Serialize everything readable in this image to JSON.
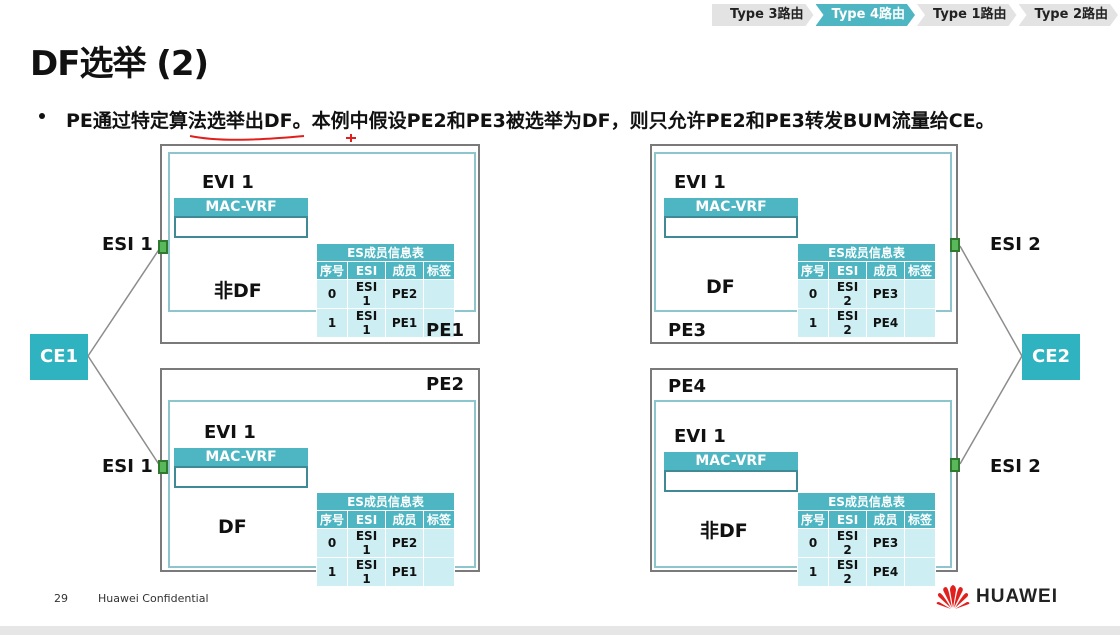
{
  "breadcrumb": {
    "items": [
      {
        "label": "Type 3路由",
        "active": false
      },
      {
        "label": "Type 4路由",
        "active": true
      },
      {
        "label": "Type 1路由",
        "active": false
      },
      {
        "label": "Type 2路由",
        "active": false
      }
    ]
  },
  "title": "DF选举 (2)",
  "bullet": "PE通过特定算法选举出DF。本例中假设PE2和PE3被选举为DF，则只允许PE2和PE3转发BUM流量给CE。",
  "colors": {
    "accent": "#4eb6c3",
    "ce_fill": "#30b3c0",
    "table_row": "#cdeef2",
    "port_green": "#59b859",
    "annotation_red": "#e0201d"
  },
  "table_caption": "ES成员信息表",
  "table_headers": [
    "序号",
    "ESI",
    "成员",
    "标签"
  ],
  "evi_label": "EVI 1",
  "macvrf_label": "MAC-VRF",
  "pes": {
    "pe1": {
      "name": "PE1",
      "role": "非DF",
      "esi_label": "ESI 1",
      "rows": [
        [
          "0",
          "ESI 1",
          "PE2",
          ""
        ],
        [
          "1",
          "ESI 1",
          "PE1",
          ""
        ]
      ]
    },
    "pe2": {
      "name": "PE2",
      "role": "DF",
      "esi_label": "ESI 1",
      "rows": [
        [
          "0",
          "ESI 1",
          "PE2",
          ""
        ],
        [
          "1",
          "ESI 1",
          "PE1",
          ""
        ]
      ]
    },
    "pe3": {
      "name": "PE3",
      "role": "DF",
      "esi_label": "ESI 2",
      "rows": [
        [
          "0",
          "ESI 2",
          "PE3",
          ""
        ],
        [
          "1",
          "ESI 2",
          "PE4",
          ""
        ]
      ]
    },
    "pe4": {
      "name": "PE4",
      "role": "非DF",
      "esi_label": "ESI 2",
      "rows": [
        [
          "0",
          "ESI 2",
          "PE3",
          ""
        ],
        [
          "1",
          "ESI 2",
          "PE4",
          ""
        ]
      ]
    }
  },
  "ce1": "CE1",
  "ce2": "CE2",
  "footer": {
    "page_number": "29",
    "confidential": "Huawei Confidential",
    "brand": "HUAWEI"
  }
}
